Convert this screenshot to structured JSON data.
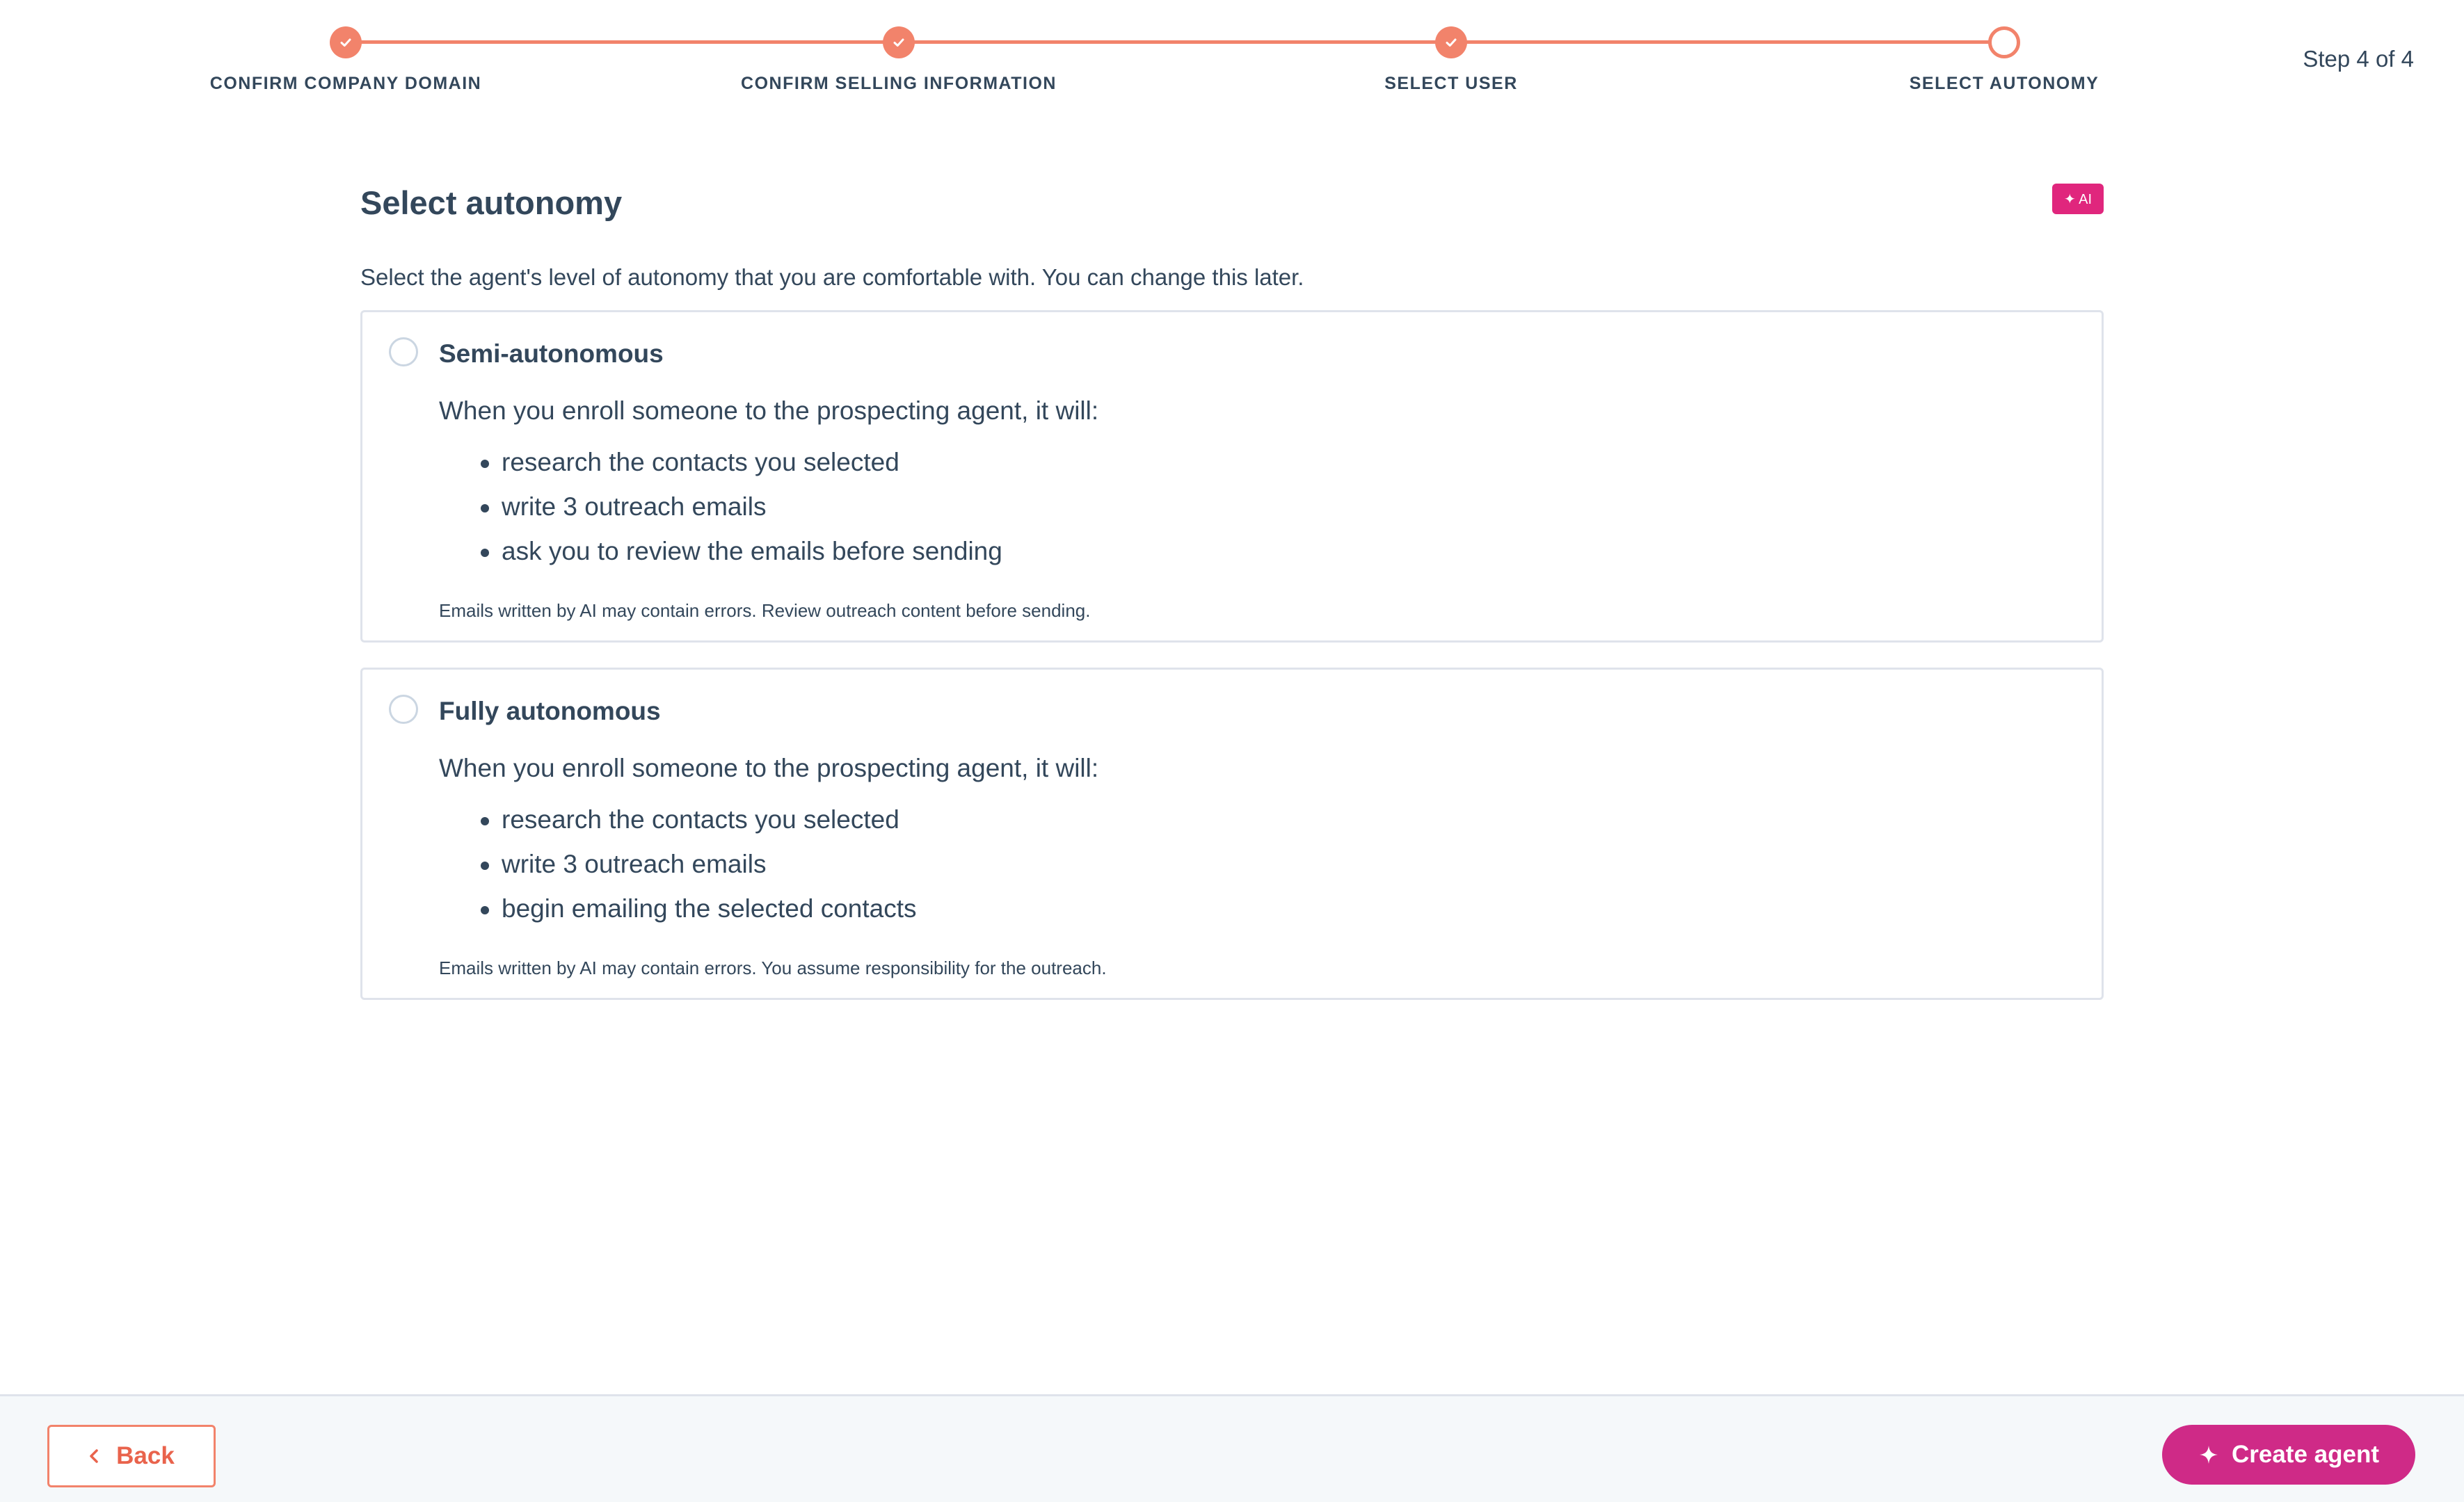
{
  "stepper": {
    "steps": [
      {
        "label": "CONFIRM COMPANY DOMAIN",
        "status": "complete"
      },
      {
        "label": "CONFIRM SELLING INFORMATION",
        "status": "complete"
      },
      {
        "label": "SELECT USER",
        "status": "complete"
      },
      {
        "label": "SELECT AUTONOMY",
        "status": "current"
      }
    ],
    "step_count": "Step 4 of 4"
  },
  "main": {
    "title": "Select autonomy",
    "ai_badge": "✦ AI",
    "description": "Select the agent's level of autonomy that you are comfortable with. You can change this later.",
    "options": [
      {
        "title": "Semi-autonomous",
        "selected": false,
        "intro": "When you enroll someone to the prospecting agent, it will:",
        "items": [
          "research the contacts you selected",
          "write 3 outreach emails",
          "ask you to review the emails before sending"
        ],
        "note": "Emails written by AI may contain errors. Review outreach content before sending."
      },
      {
        "title": "Fully autonomous",
        "selected": false,
        "intro": "When you enroll someone to the prospecting agent, it will:",
        "items": [
          "research the contacts you selected",
          "write 3 outreach emails",
          "begin emailing the selected contacts"
        ],
        "note": "Emails written by AI may contain errors. You assume responsibility for the outreach."
      }
    ]
  },
  "footer": {
    "back_label": "Back",
    "back_icon": "chevron-left-icon",
    "create_label": "Create agent",
    "create_icon": "sparkle-icon"
  },
  "colors": {
    "accent": "#f2836b",
    "brand_pink": "#cf2a87",
    "text": "#33475b",
    "border": "#dfe3eb"
  }
}
